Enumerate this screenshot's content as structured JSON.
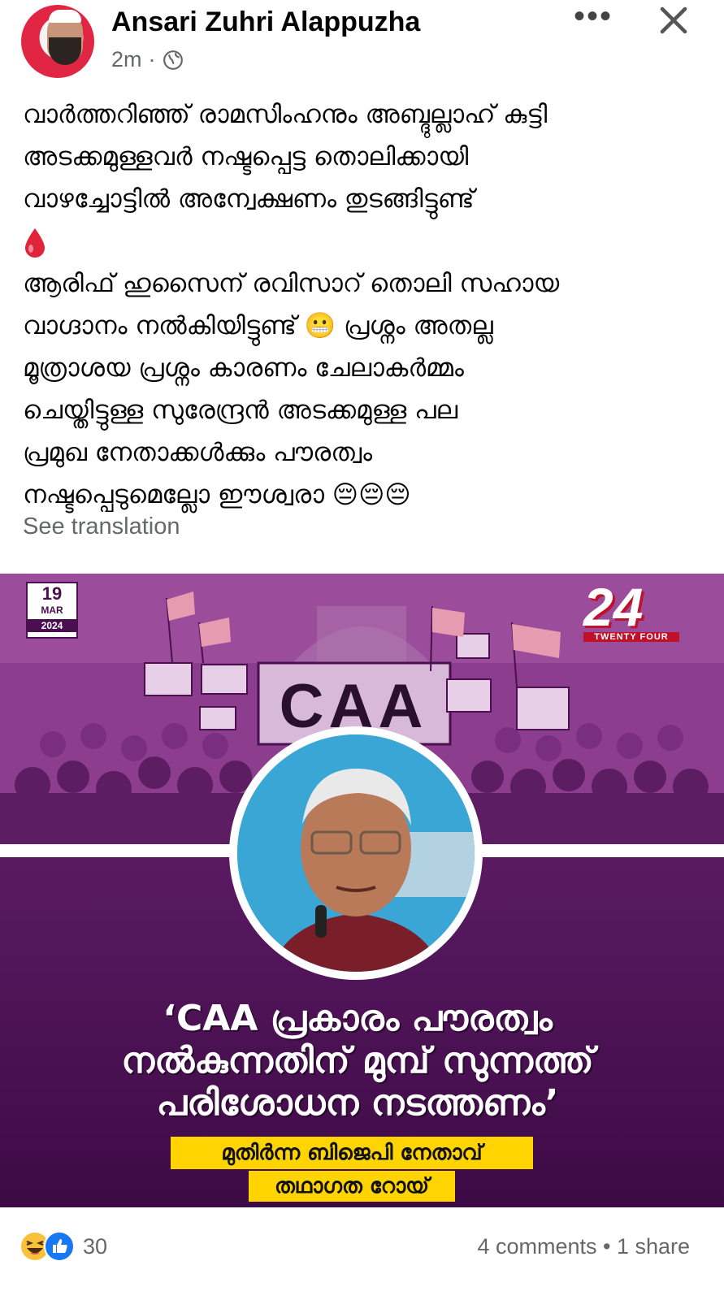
{
  "post": {
    "author": "Ansari Zuhri Alappuzha",
    "time": "2m",
    "separator": "·",
    "paragraph1": "വാർത്തറിഞ്ഞ് രാമസിംഹനും അബ്ദുല്ലാഹ് കുട്ടി\nഅടക്കമുള്ളവർ നഷ്ടപ്പെട്ട തൊലിക്കായി\nവാഴച്ചോട്ടിൽ അന്വേക്ഷണം തുടങ്ങിട്ടുണ്ട്",
    "paragraph2": " ആരിഫ് ഹുസൈന് രവിസാറ് തൊലി സഹായ\nവാഗ്ദാനം നൽകിയിട്ടുണ്ട് 😬 പ്രശ്നം അതല്ല\nമൂത്രാശയ പ്രശ്നം കാരണം ചേലാകർമ്മം\nചെയ്തിട്ടുള്ള സുരേന്ദ്രൻ അടക്കമുള്ള പല\nപ്രമുഖ നേതാക്കൾക്കും പൗരത്വം\nനഷ്ടപ്പെടുമെല്ലോ ഈശ്വരാ 😔😔😔",
    "see_translation": "See translation"
  },
  "image": {
    "date_day": "19",
    "date_month": "MAR",
    "date_year": "2024",
    "channel_number": "24",
    "channel_name": "TWENTY FOUR",
    "banner": "CAA",
    "quote": "‘CAA പ്രകാരം പൗരത്വം\nനൽകുന്നതിന് മുമ്പ് സുന്നത്ത്\nപരിശോധന നടത്തണം’",
    "source_role": "മുതിർന്ന ബിജെപി നേതാവ്",
    "source_name": "തഥാഗത റോയ്"
  },
  "footer": {
    "reaction_count": "30",
    "stats": "4 comments • 1 share"
  },
  "icons": {
    "more": "more-icon",
    "close": "close-icon",
    "globe": "globe-icon",
    "blood": "blood-drop-icon",
    "haha": "haha-icon",
    "like": "like-icon"
  },
  "colors": {
    "secondary_text": "#65676b",
    "image_purple": "#6a1f6e",
    "highlight_yellow": "#ffd400",
    "like_blue": "#1877f2"
  }
}
